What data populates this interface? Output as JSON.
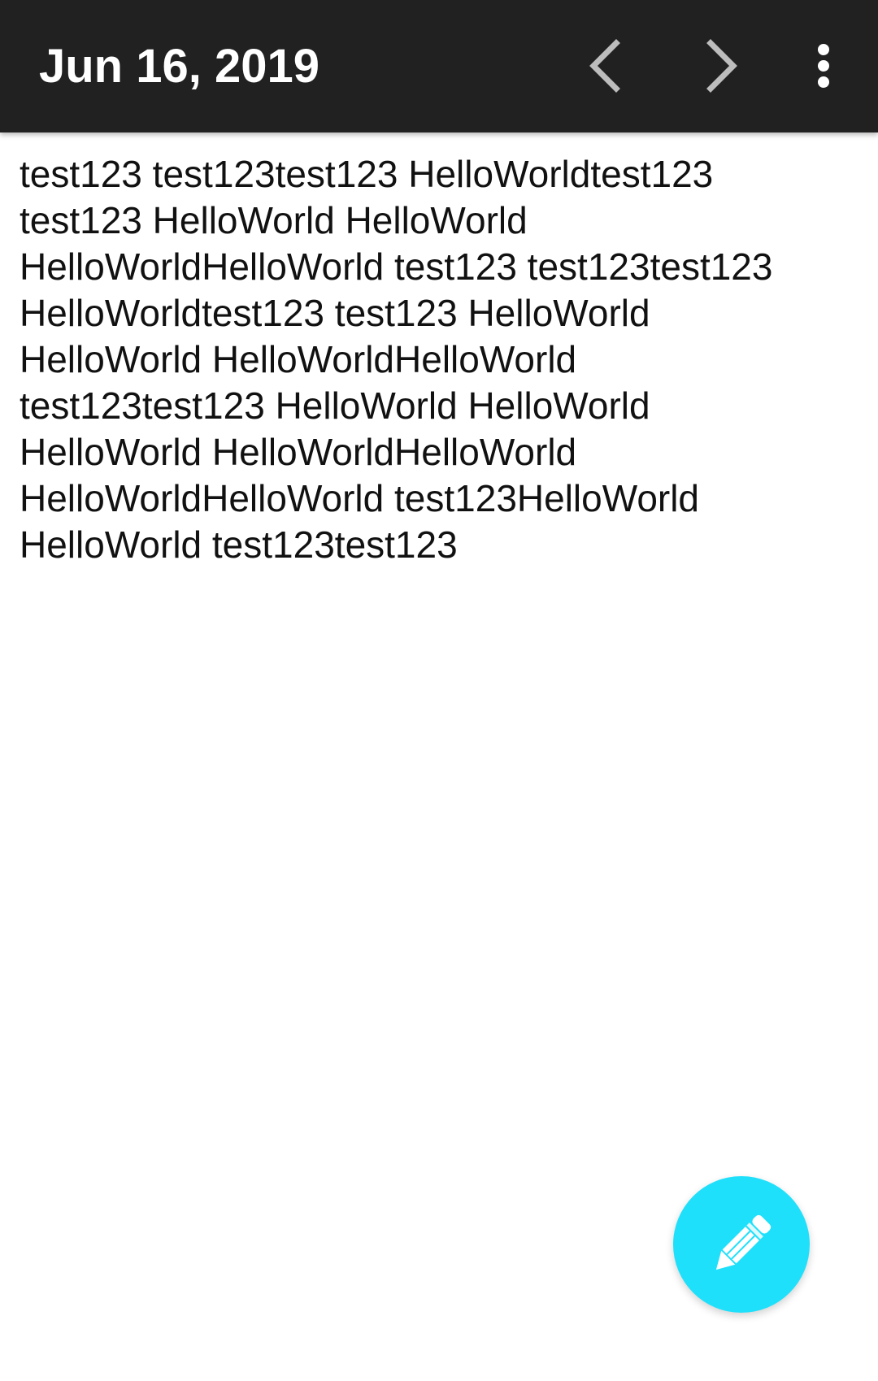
{
  "toolbar": {
    "title": "Jun 16, 2019",
    "prev_icon": "chevron-left-icon",
    "next_icon": "chevron-right-icon",
    "more_icon": "more-vert-icon",
    "background_color": "#212121"
  },
  "note": {
    "text": "test123 test123test123 HelloWorldtest123\ntest123 HelloWorld HelloWorld\nHelloWorldHelloWorld test123 test123test123\nHelloWorldtest123 test123 HelloWorld\nHelloWorld HelloWorldHelloWorld\ntest123test123 HelloWorld HelloWorld\nHelloWorld HelloWorldHelloWorld\nHelloWorldHelloWorld test123HelloWorld\nHelloWorld test123test123"
  },
  "fab": {
    "icon": "pencil-icon",
    "color": "#1FE0FB"
  }
}
